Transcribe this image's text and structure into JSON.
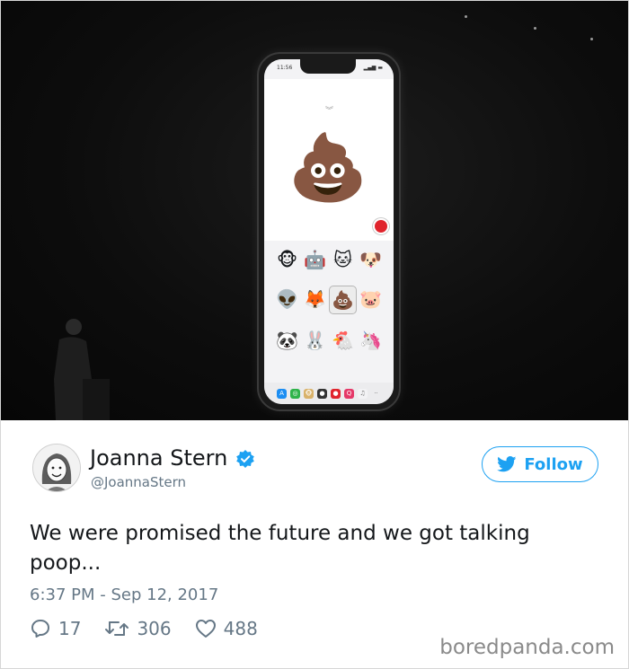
{
  "phone": {
    "status_time": "11:56",
    "status_signal": "▂▄▆ ▬",
    "preview_emoji": "💩",
    "animoji_grid": [
      "🐵",
      "🤖",
      "🐱",
      "🐶",
      "👽",
      "🦊",
      "💩",
      "🐷",
      "🐼",
      "🐰",
      "🐔",
      "🦄"
    ],
    "selected_index": 6,
    "app_drawer": [
      "A",
      "◎",
      "🐵",
      "●",
      "●",
      "Q",
      "♫",
      "··"
    ]
  },
  "tweet": {
    "author_name": "Joanna Stern",
    "author_handle": "@JoannaStern",
    "follow_label": "Follow",
    "text": "We were promised the future and we got talking poop...",
    "timestamp": "6:37 PM - Sep 12, 2017",
    "replies": "17",
    "retweets": "306",
    "likes": "488"
  },
  "watermark": "boredpanda.com",
  "colors": {
    "twitter_blue": "#1da1f2",
    "meta_gray": "#657786",
    "record_red": "#e0242c"
  }
}
